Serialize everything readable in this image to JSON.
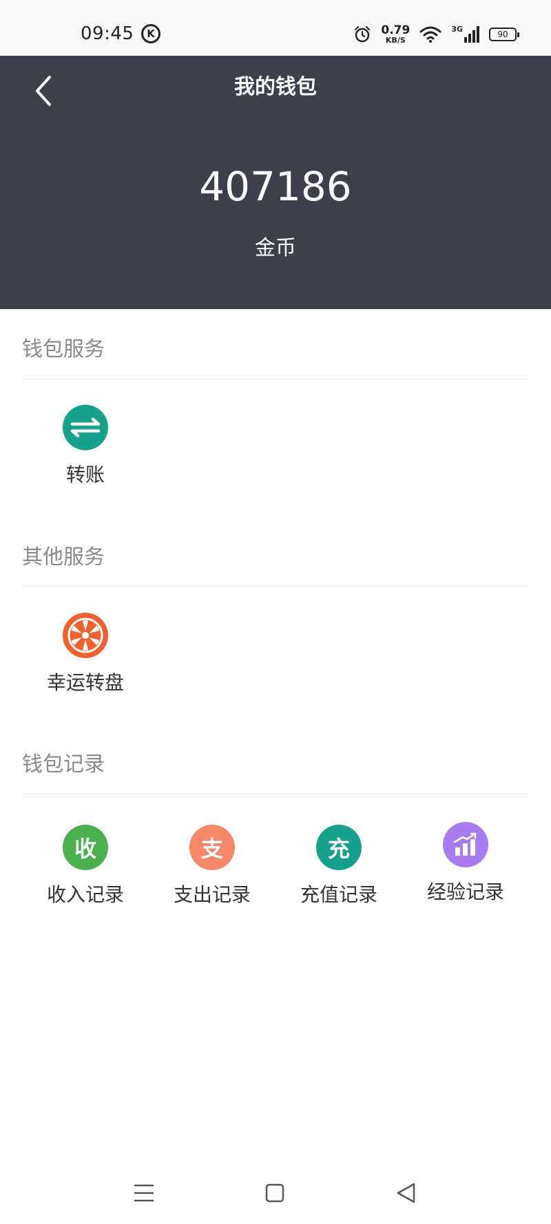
{
  "status_bar": {
    "time": "09:45",
    "app_badge": "K",
    "speed_value": "0.79",
    "speed_unit": "KB/S",
    "network": "3G",
    "battery": "90"
  },
  "header": {
    "title": "我的钱包",
    "balance": "407186",
    "balance_unit": "金币",
    "background": "#3b404c"
  },
  "sections": {
    "wallet_services": {
      "title": "钱包服务",
      "items": [
        {
          "label": "转账",
          "icon": "transfer-icon",
          "color": "#17a08a"
        }
      ]
    },
    "other_services": {
      "title": "其他服务",
      "items": [
        {
          "label": "幸运转盘",
          "icon": "lucky-wheel-icon",
          "color": "#f06030"
        }
      ]
    },
    "wallet_records": {
      "title": "钱包记录",
      "items": [
        {
          "label": "收入记录",
          "glyph": "收",
          "icon": "income-icon",
          "color": "#4caf50"
        },
        {
          "label": "支出记录",
          "glyph": "支",
          "icon": "expense-icon",
          "color": "#f5876b"
        },
        {
          "label": "充值记录",
          "glyph": "充",
          "icon": "recharge-icon",
          "color": "#17a08a"
        },
        {
          "label": "经验记录",
          "icon": "experience-chart-icon",
          "color": "#a77cf0"
        }
      ]
    }
  },
  "nav_bar": {
    "buttons": [
      "menu-icon",
      "home-icon",
      "back-icon"
    ]
  }
}
